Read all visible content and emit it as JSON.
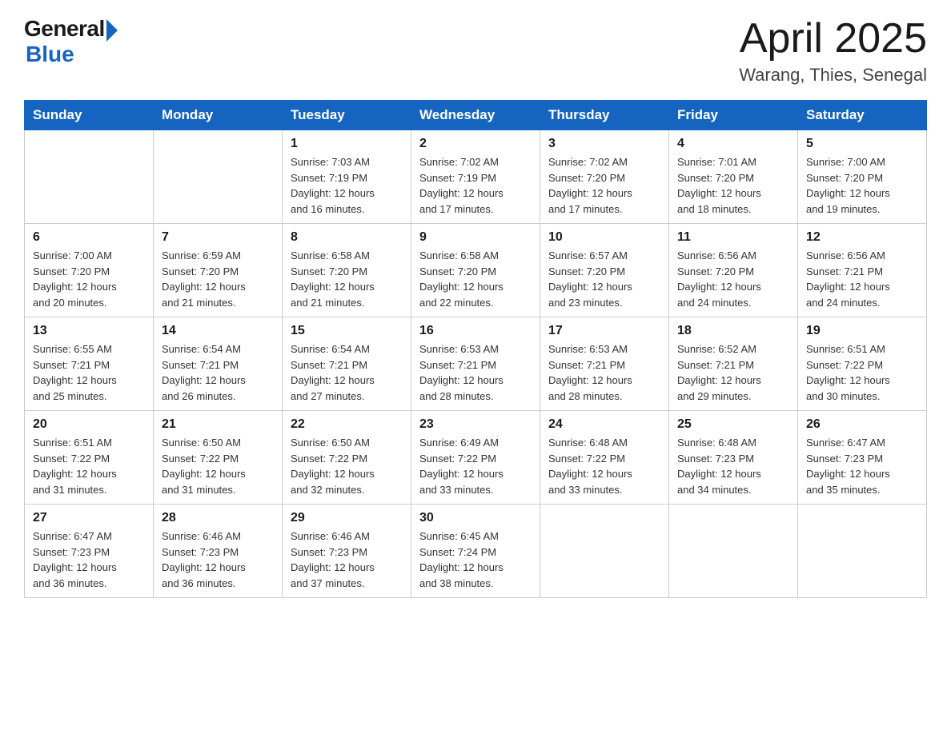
{
  "logo": {
    "general": "General",
    "blue": "Blue"
  },
  "title": {
    "month_year": "April 2025",
    "location": "Warang, Thies, Senegal"
  },
  "weekdays": [
    "Sunday",
    "Monday",
    "Tuesday",
    "Wednesday",
    "Thursday",
    "Friday",
    "Saturday"
  ],
  "weeks": [
    [
      {
        "day": "",
        "info": ""
      },
      {
        "day": "",
        "info": ""
      },
      {
        "day": "1",
        "info": "Sunrise: 7:03 AM\nSunset: 7:19 PM\nDaylight: 12 hours\nand 16 minutes."
      },
      {
        "day": "2",
        "info": "Sunrise: 7:02 AM\nSunset: 7:19 PM\nDaylight: 12 hours\nand 17 minutes."
      },
      {
        "day": "3",
        "info": "Sunrise: 7:02 AM\nSunset: 7:20 PM\nDaylight: 12 hours\nand 17 minutes."
      },
      {
        "day": "4",
        "info": "Sunrise: 7:01 AM\nSunset: 7:20 PM\nDaylight: 12 hours\nand 18 minutes."
      },
      {
        "day": "5",
        "info": "Sunrise: 7:00 AM\nSunset: 7:20 PM\nDaylight: 12 hours\nand 19 minutes."
      }
    ],
    [
      {
        "day": "6",
        "info": "Sunrise: 7:00 AM\nSunset: 7:20 PM\nDaylight: 12 hours\nand 20 minutes."
      },
      {
        "day": "7",
        "info": "Sunrise: 6:59 AM\nSunset: 7:20 PM\nDaylight: 12 hours\nand 21 minutes."
      },
      {
        "day": "8",
        "info": "Sunrise: 6:58 AM\nSunset: 7:20 PM\nDaylight: 12 hours\nand 21 minutes."
      },
      {
        "day": "9",
        "info": "Sunrise: 6:58 AM\nSunset: 7:20 PM\nDaylight: 12 hours\nand 22 minutes."
      },
      {
        "day": "10",
        "info": "Sunrise: 6:57 AM\nSunset: 7:20 PM\nDaylight: 12 hours\nand 23 minutes."
      },
      {
        "day": "11",
        "info": "Sunrise: 6:56 AM\nSunset: 7:20 PM\nDaylight: 12 hours\nand 24 minutes."
      },
      {
        "day": "12",
        "info": "Sunrise: 6:56 AM\nSunset: 7:21 PM\nDaylight: 12 hours\nand 24 minutes."
      }
    ],
    [
      {
        "day": "13",
        "info": "Sunrise: 6:55 AM\nSunset: 7:21 PM\nDaylight: 12 hours\nand 25 minutes."
      },
      {
        "day": "14",
        "info": "Sunrise: 6:54 AM\nSunset: 7:21 PM\nDaylight: 12 hours\nand 26 minutes."
      },
      {
        "day": "15",
        "info": "Sunrise: 6:54 AM\nSunset: 7:21 PM\nDaylight: 12 hours\nand 27 minutes."
      },
      {
        "day": "16",
        "info": "Sunrise: 6:53 AM\nSunset: 7:21 PM\nDaylight: 12 hours\nand 28 minutes."
      },
      {
        "day": "17",
        "info": "Sunrise: 6:53 AM\nSunset: 7:21 PM\nDaylight: 12 hours\nand 28 minutes."
      },
      {
        "day": "18",
        "info": "Sunrise: 6:52 AM\nSunset: 7:21 PM\nDaylight: 12 hours\nand 29 minutes."
      },
      {
        "day": "19",
        "info": "Sunrise: 6:51 AM\nSunset: 7:22 PM\nDaylight: 12 hours\nand 30 minutes."
      }
    ],
    [
      {
        "day": "20",
        "info": "Sunrise: 6:51 AM\nSunset: 7:22 PM\nDaylight: 12 hours\nand 31 minutes."
      },
      {
        "day": "21",
        "info": "Sunrise: 6:50 AM\nSunset: 7:22 PM\nDaylight: 12 hours\nand 31 minutes."
      },
      {
        "day": "22",
        "info": "Sunrise: 6:50 AM\nSunset: 7:22 PM\nDaylight: 12 hours\nand 32 minutes."
      },
      {
        "day": "23",
        "info": "Sunrise: 6:49 AM\nSunset: 7:22 PM\nDaylight: 12 hours\nand 33 minutes."
      },
      {
        "day": "24",
        "info": "Sunrise: 6:48 AM\nSunset: 7:22 PM\nDaylight: 12 hours\nand 33 minutes."
      },
      {
        "day": "25",
        "info": "Sunrise: 6:48 AM\nSunset: 7:23 PM\nDaylight: 12 hours\nand 34 minutes."
      },
      {
        "day": "26",
        "info": "Sunrise: 6:47 AM\nSunset: 7:23 PM\nDaylight: 12 hours\nand 35 minutes."
      }
    ],
    [
      {
        "day": "27",
        "info": "Sunrise: 6:47 AM\nSunset: 7:23 PM\nDaylight: 12 hours\nand 36 minutes."
      },
      {
        "day": "28",
        "info": "Sunrise: 6:46 AM\nSunset: 7:23 PM\nDaylight: 12 hours\nand 36 minutes."
      },
      {
        "day": "29",
        "info": "Sunrise: 6:46 AM\nSunset: 7:23 PM\nDaylight: 12 hours\nand 37 minutes."
      },
      {
        "day": "30",
        "info": "Sunrise: 6:45 AM\nSunset: 7:24 PM\nDaylight: 12 hours\nand 38 minutes."
      },
      {
        "day": "",
        "info": ""
      },
      {
        "day": "",
        "info": ""
      },
      {
        "day": "",
        "info": ""
      }
    ]
  ]
}
